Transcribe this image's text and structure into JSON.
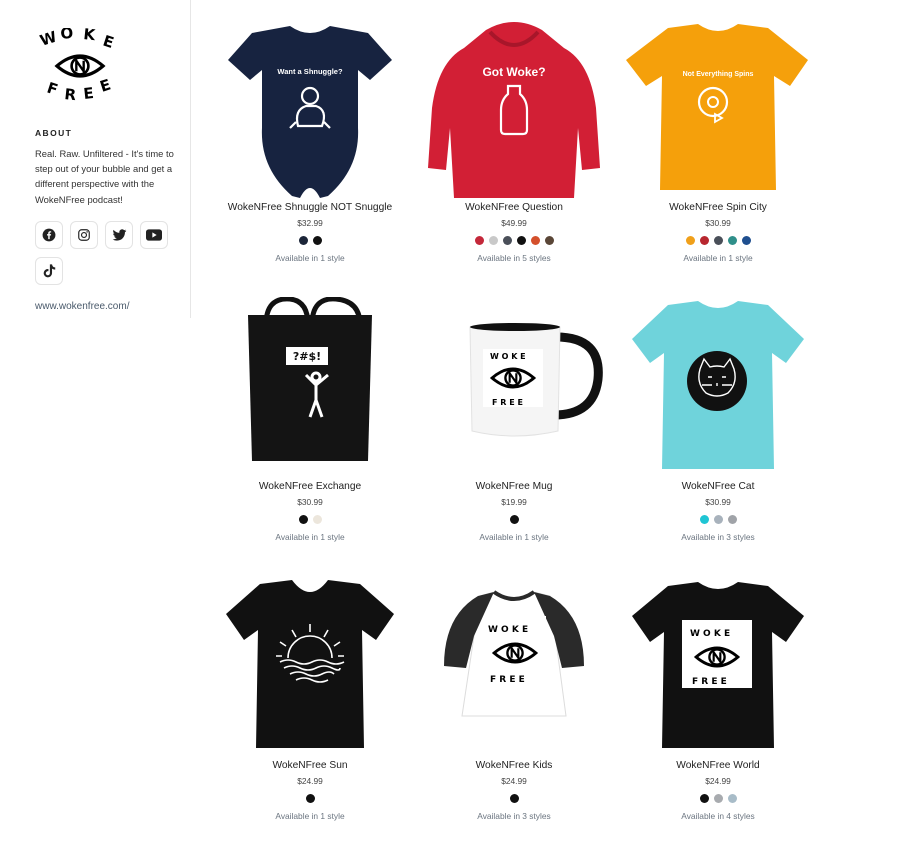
{
  "sidebar": {
    "logo_text": {
      "top": "WOKE",
      "middle": "N",
      "bottom": "FREE"
    },
    "about_heading": "ABOUT",
    "about_text": "Real. Raw. Unfiltered - It's time to step out of your bubble and get a different perspective with the WokeNFree podcast!",
    "social": [
      "facebook-icon",
      "instagram-icon",
      "twitter-icon",
      "youtube-icon",
      "tiktok-icon"
    ],
    "website": "www.wokenfree.com/"
  },
  "products": [
    {
      "name": "WokeNFree Shnuggle NOT Snuggle",
      "price": "$32.99",
      "colors": [
        "#1b2538",
        "#111111"
      ],
      "availability": "Available in 1 style",
      "print_text": "Want a Shnuggle?",
      "garment_color": "#172340"
    },
    {
      "name": "WokeNFree Question",
      "price": "$49.99",
      "colors": [
        "#c4283a",
        "#c9c9c9",
        "#4a4f59",
        "#111111",
        "#d4502c",
        "#5a4637"
      ],
      "availability": "Available in 5 styles",
      "print_text": "Got Woke?",
      "garment_color": "#d21f35"
    },
    {
      "name": "WokeNFree Spin City",
      "price": "$30.99",
      "colors": [
        "#f0a01a",
        "#b8272f",
        "#4a4f59",
        "#2f8f8a",
        "#1f4f8f"
      ],
      "availability": "Available in 1 style",
      "print_text": "Not Everything Spins",
      "garment_color": "#f5a00b"
    },
    {
      "name": "WokeNFree Exchange",
      "price": "$30.99",
      "colors": [
        "#111111",
        "#ece6dc"
      ],
      "availability": "Available in 1 style",
      "print_text": "?#$!",
      "garment_color": "#111111"
    },
    {
      "name": "WokeNFree Mug",
      "price": "$19.99",
      "colors": [
        "#111111"
      ],
      "availability": "Available in 1 style",
      "print_text": "",
      "garment_color": "#ffffff"
    },
    {
      "name": "WokeNFree Cat",
      "price": "$30.99",
      "colors": [
        "#1fc5d4",
        "#a8b2bc",
        "#a0a3a8"
      ],
      "availability": "Available in 3 styles",
      "print_text": "",
      "garment_color": "#6fd3db"
    },
    {
      "name": "WokeNFree Sun",
      "price": "$24.99",
      "colors": [
        "#111111"
      ],
      "availability": "Available in 1 style",
      "print_text": "",
      "garment_color": "#111111"
    },
    {
      "name": "WokeNFree Kids",
      "price": "$24.99",
      "colors": [
        "#111111"
      ],
      "availability": "Available in 3 styles",
      "print_text": "",
      "garment_color": "#ffffff"
    },
    {
      "name": "WokeNFree World",
      "price": "$24.99",
      "colors": [
        "#111111",
        "#a8abaf",
        "#a8bcc8"
      ],
      "availability": "Available in 4 styles",
      "print_text": "",
      "garment_color": "#111111"
    }
  ]
}
